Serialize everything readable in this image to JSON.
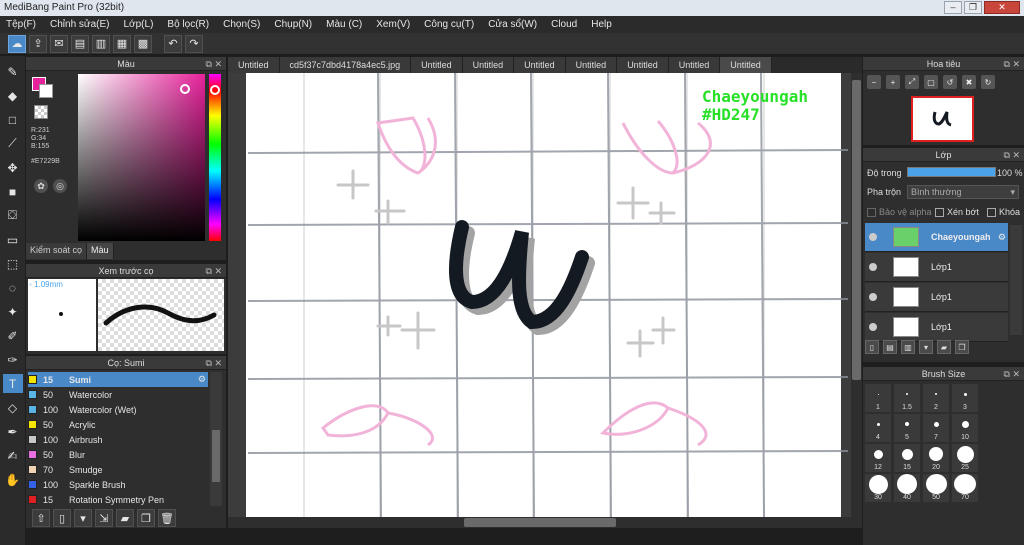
{
  "window": {
    "title": "MediBang Paint Pro (32bit)"
  },
  "menu": [
    "Tệp(F)",
    "Chỉnh sửa(E)",
    "Lớp(L)",
    "Bộ lọc(R)",
    "Chọn(S)",
    "Chụp(N)",
    "Màu (C)",
    "Xem(V)",
    "Công cụ(T)",
    "Cửa sổ(W)",
    "Cloud",
    "Help"
  ],
  "color_panel": {
    "title": "Màu",
    "current_color": "#E7229B",
    "r": "R:231",
    "g": "G:34",
    "b": "B:155",
    "hex": "#E7229B",
    "tabs": [
      "Kiểm soát cọ",
      "Màu"
    ]
  },
  "preview_panel": {
    "title": "Xem trước cọ",
    "size": "1.09mm"
  },
  "brush_panel": {
    "title": "Cọ: Sumi",
    "brushes": [
      {
        "size": "15",
        "name": "Sumi",
        "color": "#f5e400"
      },
      {
        "size": "50",
        "name": "Watercolor",
        "color": "#5ab4e6"
      },
      {
        "size": "100",
        "name": "Watercolor (Wet)",
        "color": "#5ab4e6"
      },
      {
        "size": "50",
        "name": "Acrylic",
        "color": "#f5e400"
      },
      {
        "size": "100",
        "name": "Airbrush",
        "color": "#c8c8c8"
      },
      {
        "size": "50",
        "name": "Blur",
        "color": "#e96ee0"
      },
      {
        "size": "70",
        "name": "Smudge",
        "color": "#f0d2b4"
      },
      {
        "size": "100",
        "name": "Sparkle Brush",
        "color": "#3560e8"
      },
      {
        "size": "15",
        "name": "Rotation Symmetry Pen",
        "color": "#e02020"
      }
    ]
  },
  "tabs": [
    "Untitled",
    "cd5f37c7dbd4178a4ec5.jpg",
    "Untitled",
    "Untitled",
    "Untitled",
    "Untitled",
    "Untitled",
    "Untitled",
    "Untitled"
  ],
  "canvas": {
    "watermark_line1": "Chaeyoungah",
    "watermark_line2": "#HD247"
  },
  "navigator": {
    "title": "Hoa tiêu"
  },
  "layer_panel": {
    "title": "Lớp",
    "opacity_label": "Độ trong",
    "opacity_value": "100 %",
    "opacity_fraction": 1.0,
    "blend_label": "Pha trộn",
    "blend_value": "Bình thường",
    "protect_alpha": "Bảo vệ alpha",
    "clipping": "Xén bớt",
    "lock": "Khóa",
    "layers": [
      {
        "name": "Chaeyoungah",
        "selected": true
      },
      {
        "name": "Lớp1",
        "selected": false
      },
      {
        "name": "Lớp1",
        "selected": false
      },
      {
        "name": "Lớp1",
        "selected": false
      }
    ]
  },
  "size_panel": {
    "title": "Brush Size",
    "sizes": [
      "1",
      "1.5",
      "2",
      "3",
      "4",
      "5",
      "7",
      "10",
      "12",
      "15",
      "20",
      "25",
      "30",
      "40",
      "50",
      "70"
    ]
  }
}
